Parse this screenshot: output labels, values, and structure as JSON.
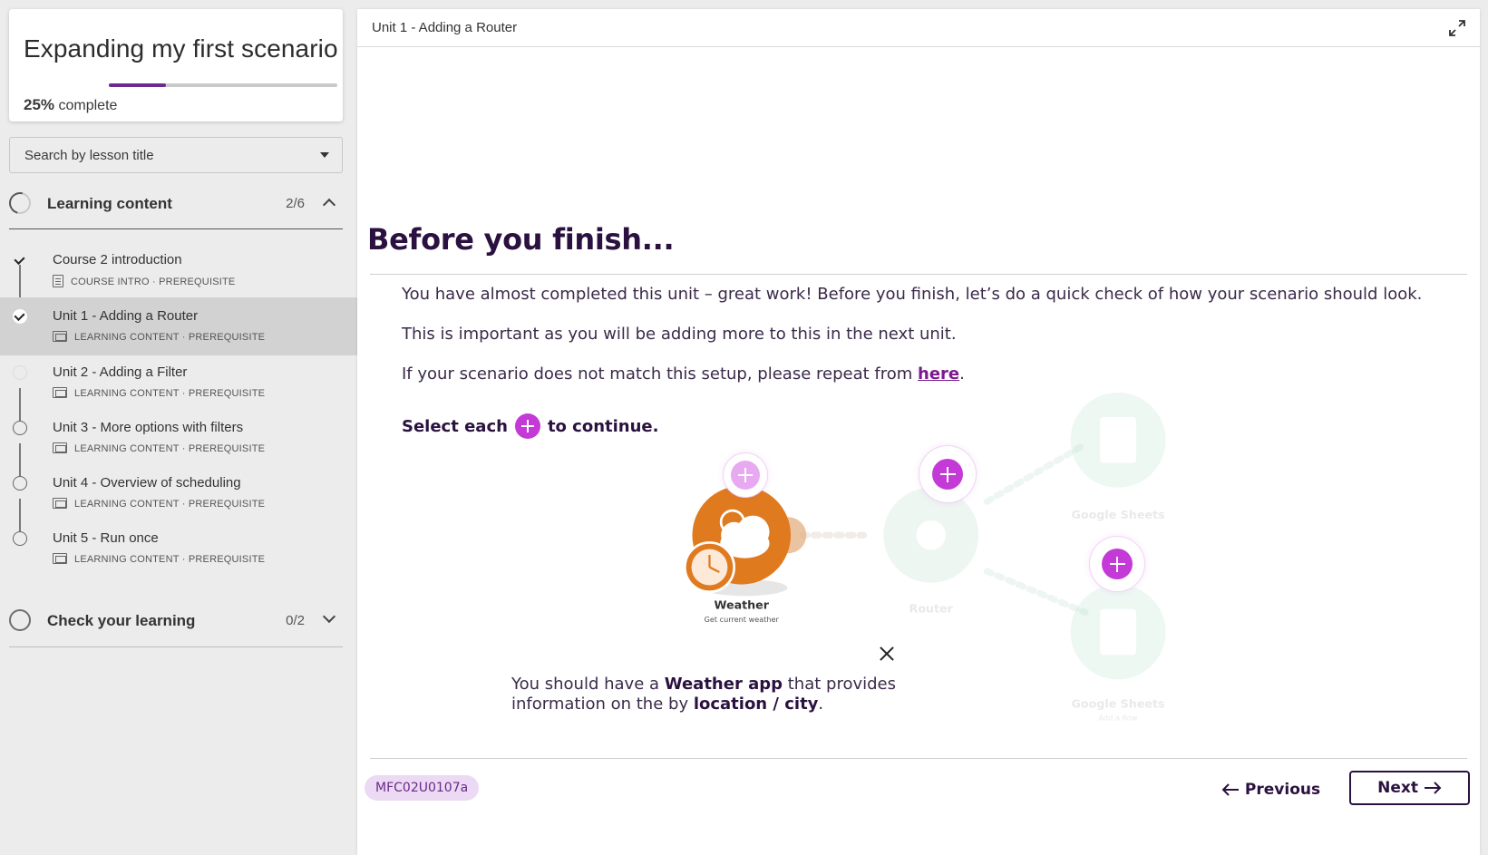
{
  "course": {
    "title": "Expanding my first scenario",
    "progress_percent": 25,
    "progress_value": "25%",
    "progress_suffix": "complete"
  },
  "search": {
    "label": "Search by lesson title"
  },
  "sections": [
    {
      "title": "Learning content",
      "count": "2/6",
      "expanded": true
    },
    {
      "title": "Check your learning",
      "count": "0/2",
      "expanded": false
    }
  ],
  "lessons": [
    {
      "title": "Course 2 introduction",
      "type": "COURSE INTRO",
      "tag": "PREREQUISITE",
      "status": "done"
    },
    {
      "title": "Unit 1 - Adding a Router",
      "type": "LEARNING CONTENT",
      "tag": "PREREQUISITE",
      "status": "done-active"
    },
    {
      "title": "Unit 2 - Adding a Filter",
      "type": "LEARNING CONTENT",
      "tag": "PREREQUISITE",
      "status": "current"
    },
    {
      "title": "Unit 3 - More options with filters",
      "type": "LEARNING CONTENT",
      "tag": "PREREQUISITE",
      "status": "open"
    },
    {
      "title": "Unit 4 - Overview of scheduling",
      "type": "LEARNING CONTENT",
      "tag": "PREREQUISITE",
      "status": "open"
    },
    {
      "title": "Unit 5 - Run once",
      "type": "LEARNING CONTENT",
      "tag": "PREREQUISITE",
      "status": "open"
    }
  ],
  "meta_separator": " · ",
  "main": {
    "breadcrumb": "Unit 1 - Adding a Router",
    "heading": "Before you finish...",
    "para1": "You have almost completed this unit – great work! Before you finish, let’s do a quick check of how your scenario should look.",
    "para2": "This is important as you will be adding more to this in the next unit.",
    "para3_prefix": "If your scenario does not match this setup, please repeat from ",
    "para3_link": "here",
    "para3_suffix": ".",
    "select_prefix": "Select each",
    "select_suffix": "to continue."
  },
  "diagram": {
    "weather": {
      "name": "Weather",
      "subtitle": "Get current weather",
      "color": "#e07a1f"
    },
    "router": {
      "name": "Router"
    },
    "sheets_top": {
      "name": "Google Sheets"
    },
    "sheets_bottom": {
      "name": "Google Sheets",
      "subtitle": "Add a Row"
    },
    "callout": {
      "t1": "You should have a ",
      "b1": "Weather app",
      "t2": " that provides",
      "t3": "information on the by ",
      "b2": "location / city",
      "t4": "."
    }
  },
  "footer": {
    "code": "MFC02U0107a",
    "prev_label": "Previous",
    "next_label": "Next"
  },
  "colors": {
    "accent": "#c43ad6",
    "brand_dark": "#2a1140",
    "progress": "#6d2b8f"
  }
}
